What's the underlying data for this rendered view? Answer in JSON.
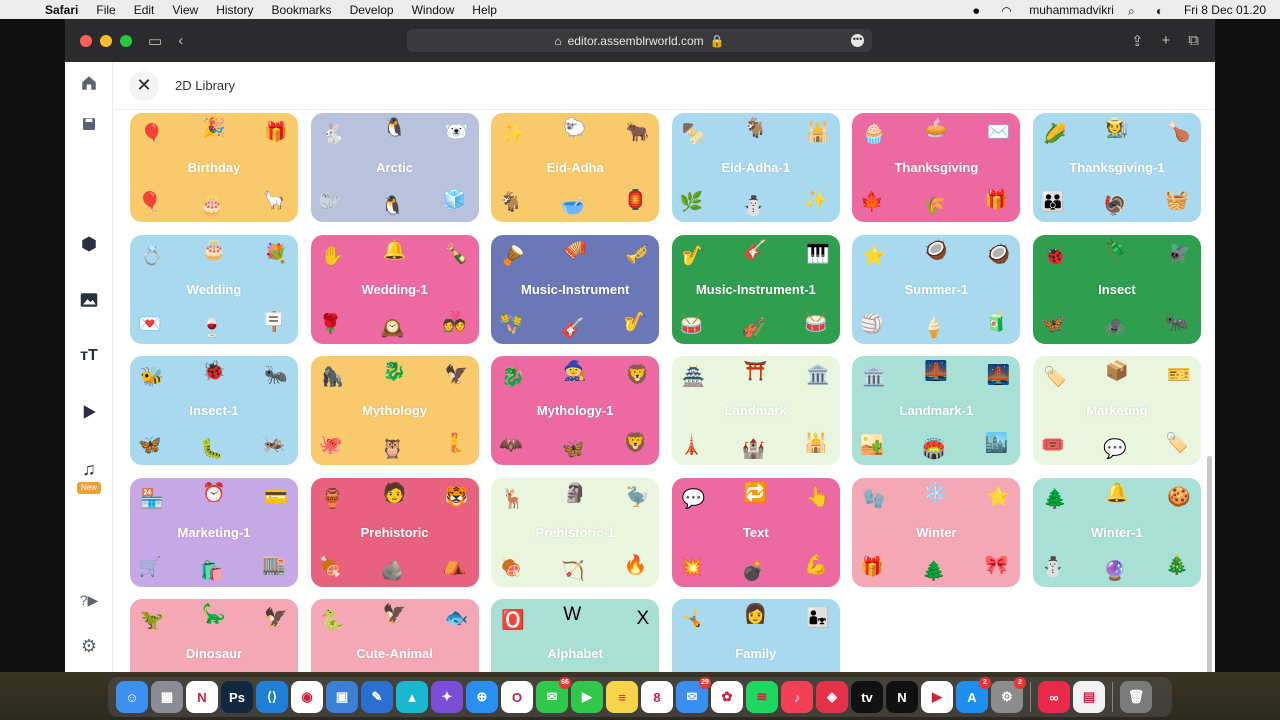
{
  "menubar": {
    "app": "Safari",
    "items": [
      "File",
      "Edit",
      "View",
      "History",
      "Bookmarks",
      "Develop",
      "Window",
      "Help"
    ],
    "user": "muhammadvikri",
    "datetime": "Fri 8 Dec  01.20"
  },
  "browser": {
    "url": "editor.assemblrworld.com",
    "traffic_colors": [
      "#ff5f57",
      "#febc2e",
      "#28c840"
    ]
  },
  "sidebar": {
    "new_badge": "New",
    "icons": [
      "home-icon",
      "save-icon",
      "cube-icon",
      "image-icon",
      "text-icon",
      "play-icon",
      "music-icon",
      "help-video-icon",
      "gear-icon"
    ]
  },
  "panel": {
    "title": "2D Library"
  },
  "library": [
    {
      "label": "Birthday",
      "color": "#f9ca6b",
      "decos": [
        "🎈",
        "🎉",
        "🎁",
        "🎈",
        "🎂",
        "🦙"
      ]
    },
    {
      "label": "Arctic",
      "color": "#b8c2dc",
      "decos": [
        "🐇",
        "🐧",
        "🐻‍❄️",
        "🦭",
        "🐧",
        "🧊"
      ]
    },
    {
      "label": "Eid-Adha",
      "color": "#f9ca6b",
      "decos": [
        "✨",
        "🐑",
        "🐂",
        "🐐",
        "🥣",
        "🏮"
      ]
    },
    {
      "label": "Eid-Adha-1",
      "color": "#a9d9ef",
      "decos": [
        "🍢",
        "🐐",
        "🕌",
        "🌿",
        "⛄",
        "✨"
      ]
    },
    {
      "label": "Thanksgiving",
      "color": "#ec6aa1",
      "decos": [
        "🧁",
        "🥧",
        "✉️",
        "🍁",
        "🌾",
        "🎁"
      ]
    },
    {
      "label": "Thanksgiving-1",
      "color": "#a9d9ef",
      "decos": [
        "🌽",
        "🧑‍🌾",
        "🍗",
        "👪",
        "🦃",
        "🧺"
      ]
    },
    {
      "label": "Wedding",
      "color": "#a9d9ef",
      "decos": [
        "💍",
        "🎂",
        "💐",
        "💌",
        "🍷",
        "🪧"
      ]
    },
    {
      "label": "Wedding-1",
      "color": "#ec6aa1",
      "decos": [
        "✋",
        "🔔",
        "🍾",
        "🌹",
        "🕰️",
        "💑"
      ]
    },
    {
      "label": "Music-Instrument",
      "color": "#6a78b8",
      "decos": [
        "🪘",
        "🪗",
        "🎺",
        "🪇",
        "🎸",
        "🎷"
      ]
    },
    {
      "label": "Music-Instrument-1",
      "color": "#2f9e4e",
      "decos": [
        "🎷",
        "🎸",
        "🎹",
        "🥁",
        "🎻",
        "🥁"
      ]
    },
    {
      "label": "Summer-1",
      "color": "#a9d9ef",
      "decos": [
        "⭐",
        "🥥",
        "🥥",
        "🏐",
        "🍦",
        "🧃"
      ]
    },
    {
      "label": "Insect",
      "color": "#2f9e4e",
      "decos": [
        "🐞",
        "🪲",
        "🪰",
        "🦋",
        "🕷️",
        "🐜"
      ]
    },
    {
      "label": "Insect-1",
      "color": "#a9d9ef",
      "decos": [
        "🐝",
        "🐞",
        "🐜",
        "🦋",
        "🐛",
        "🦗"
      ]
    },
    {
      "label": "Mythology",
      "color": "#f9ca6b",
      "decos": [
        "🦍",
        "🐉",
        "🦅",
        "🐙",
        "🦉",
        "🧜"
      ]
    },
    {
      "label": "Mythology-1",
      "color": "#ec6aa1",
      "decos": [
        "🐉",
        "🧙",
        "🦁",
        "🦇",
        "🦋",
        "🦁"
      ]
    },
    {
      "label": "Landmark",
      "color": "#e9f5dc",
      "decos": [
        "🏯",
        "⛩️",
        "🏛️",
        "🗼",
        "🏰",
        "🕌"
      ]
    },
    {
      "label": "Landmark-1",
      "color": "#a9e0d6",
      "decos": [
        "🏛️",
        "🌉",
        "🌉",
        "🏜️",
        "🏟️",
        "🏙️"
      ]
    },
    {
      "label": "Marketing",
      "color": "#e9f5dc",
      "decos": [
        "🏷️",
        "📦",
        "🎫",
        "🎟️",
        "💬",
        "🏷️"
      ]
    },
    {
      "label": "Marketing-1",
      "color": "#c7a8e6",
      "decos": [
        "🏪",
        "⏰",
        "💳",
        "🛒",
        "🛍️",
        "🏬"
      ]
    },
    {
      "label": "Prehistoric",
      "color": "#e8617e",
      "decos": [
        "🏺",
        "🧑",
        "🐯",
        "🍖",
        "🪨",
        "⛺"
      ]
    },
    {
      "label": "Prehistoric-1",
      "color": "#e9f5dc",
      "decos": [
        "🦌",
        "🗿",
        "🦤",
        "🍖",
        "🏹",
        "🔥"
      ]
    },
    {
      "label": "Text",
      "color": "#ec6aa1",
      "decos": [
        "💬",
        "🔁",
        "👆",
        "💥",
        "💣",
        "💪"
      ]
    },
    {
      "label": "Winter",
      "color": "#f4a7b4",
      "decos": [
        "🧤",
        "❄️",
        "⭐",
        "🎁",
        "🌲",
        "🎀"
      ]
    },
    {
      "label": "Winter-1",
      "color": "#a9e0d6",
      "decos": [
        "🌲",
        "🔔",
        "🍪",
        "⛄",
        "🔮",
        "🎄"
      ]
    },
    {
      "label": "Dinosaur",
      "color": "#f4a7b4",
      "decos": [
        "🦖",
        "🦕",
        "🦅",
        "",
        "",
        ""
      ]
    },
    {
      "label": "Cute-Animal",
      "color": "#f4a7b4",
      "decos": [
        "🐍",
        "🦅",
        "🐟",
        "",
        "",
        ""
      ]
    },
    {
      "label": "Alphabet",
      "color": "#a9e0d6",
      "decos": [
        "🅾️",
        "W",
        "X",
        "",
        "",
        ""
      ]
    },
    {
      "label": "Family",
      "color": "#a9d9ef",
      "decos": [
        "🤸",
        "👩",
        "👨‍👧",
        "",
        "",
        ""
      ]
    }
  ],
  "dock": [
    {
      "name": "finder-icon",
      "color": "#3d8ff0",
      "glyph": "☺"
    },
    {
      "name": "launchpad-icon",
      "color": "#8c8c96",
      "glyph": "▦"
    },
    {
      "name": "notion-icon",
      "color": "#ffffff",
      "glyph": "N"
    },
    {
      "name": "photoshop-icon",
      "color": "#0f2740",
      "glyph": "Ps"
    },
    {
      "name": "vscode-icon",
      "color": "#1f7ed6",
      "glyph": "⟨⟩"
    },
    {
      "name": "app-icon-1",
      "color": "#ffffff",
      "glyph": "◉"
    },
    {
      "name": "preview-icon",
      "color": "#3b7fd6",
      "glyph": "▣"
    },
    {
      "name": "pen-app-icon",
      "color": "#2b6fd0",
      "glyph": "✎"
    },
    {
      "name": "files-icon",
      "color": "#19b8d0",
      "glyph": "▲"
    },
    {
      "name": "affinity-icon",
      "color": "#7c4dd6",
      "glyph": "✦"
    },
    {
      "name": "safari-icon",
      "color": "#2a8ff0",
      "glyph": "⊕"
    },
    {
      "name": "opera-icon",
      "color": "#ffffff",
      "glyph": "O"
    },
    {
      "name": "messages-icon",
      "color": "#2fc84a",
      "glyph": "✉",
      "badge": "66"
    },
    {
      "name": "facetime-icon",
      "color": "#2fc84a",
      "glyph": "▶"
    },
    {
      "name": "notes-icon",
      "color": "#f7d34a",
      "glyph": "≡"
    },
    {
      "name": "calendar-icon",
      "color": "#ffffff",
      "glyph": "8"
    },
    {
      "name": "mail-icon",
      "color": "#3a8ef0",
      "glyph": "✉",
      "badge": "29"
    },
    {
      "name": "photos-icon",
      "color": "#ffffff",
      "glyph": "✿"
    },
    {
      "name": "spotify-icon",
      "color": "#1ed760",
      "glyph": "≋"
    },
    {
      "name": "music-icon",
      "color": "#f43f57",
      "glyph": "♪"
    },
    {
      "name": "app-icon-2",
      "color": "#e2334a",
      "glyph": "◈"
    },
    {
      "name": "appletv-icon",
      "color": "#111111",
      "glyph": "tv"
    },
    {
      "name": "netflix-icon",
      "color": "#111111",
      "glyph": "N"
    },
    {
      "name": "youtube-icon",
      "color": "#ffffff",
      "glyph": "▶"
    },
    {
      "name": "appstore-icon",
      "color": "#1e8ff0",
      "glyph": "A",
      "badge": "2"
    },
    {
      "name": "settings-icon",
      "color": "#8c8c8c",
      "glyph": "⚙",
      "badge": "2"
    },
    {
      "name": "creative-cloud-icon",
      "color": "#e8294a",
      "glyph": "∞"
    },
    {
      "name": "notes-widget-icon",
      "color": "#f2f2f2",
      "glyph": "▤"
    },
    {
      "name": "trash-icon",
      "color": "#7a7a7a",
      "glyph": "🗑"
    }
  ]
}
